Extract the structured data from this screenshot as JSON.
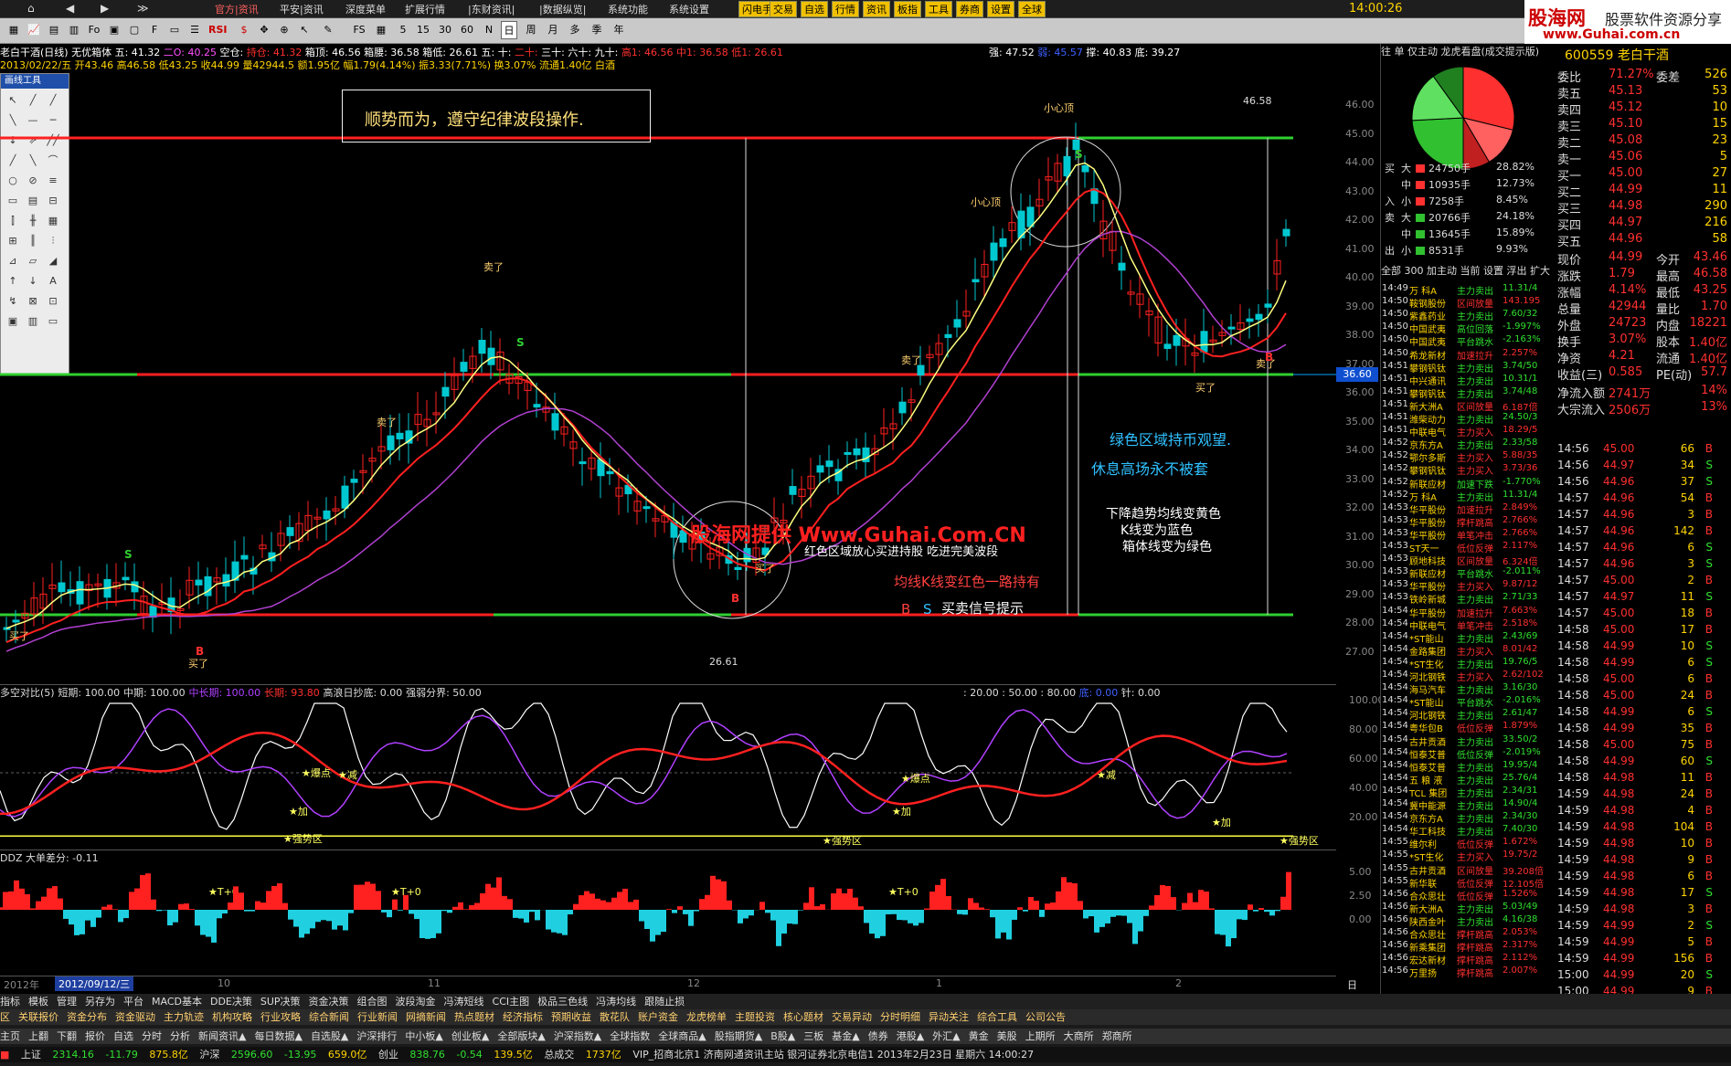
{
  "menu": [
    "官方|资讯",
    "平安|资讯",
    "深度菜单",
    "扩展行情",
    "|东财资讯|",
    "|数据纵览|",
    "系统功能",
    "系统设置"
  ],
  "yellow_buttons": [
    "闪电手",
    "交易",
    "自选",
    "行情",
    "资讯",
    "板指",
    "工具",
    "券商",
    "设置",
    "全球"
  ],
  "clock": "14:00:26",
  "brand": {
    "title": "股海网",
    "subtitle": "股票软件资源分享",
    "url": "www.Guhai.com.cn"
  },
  "toolbar_icons": [
    "RSI",
    "5",
    "15",
    "30",
    "60",
    "N",
    "日",
    "周",
    "月",
    "多",
    "季",
    "年"
  ],
  "info_line1": {
    "name": "老白干酒(日线)",
    "rights": "无优箱体",
    "wu": "五: 41.32",
    "er": "二O: 40.25",
    "kong": "空仓:",
    "shou": "持仓: 41.32",
    "xiang": "箱顶: 46.56",
    "xiang2": "箱腰: 36.58",
    "xiang3": "箱低: 26.61",
    "wu2": "五:",
    "shi": "十:",
    "ershi": "二十:",
    "sanshi": "三十:",
    "liushi": "六十:",
    "jiushi": "九十:",
    "high": "高1: 46.56",
    "mid": "中1: 36.58",
    "low": "低1: 26.61",
    "qiang": "强: 47.52",
    "ruo": "弱: 45.57",
    "cheng": "撑: 40.83",
    "di": "底: 39.27"
  },
  "info_line2": "2013/02/22/五 开43.46 高46.58 低43.25 收44.99 量42944.5 额1.95亿 幅1.79(4.14%) 振3.33(7.71%) 换3.07% 流通1.40亿 白酒",
  "drawtool": {
    "title": "画线工具",
    "icons": [
      "↖",
      "╱",
      "╱",
      "╲",
      "—",
      "─",
      "↕",
      "⇗",
      "╱╱",
      "╱",
      "╲",
      "⌒",
      "○",
      "⊘",
      "≡",
      "▭",
      "▤",
      "⊟",
      "⫿",
      "╫",
      "▦",
      "⊞",
      "║",
      "⫶",
      "⊿",
      "▱",
      "◢",
      "↑",
      "↓",
      "A",
      "↯",
      "⊠",
      "⊡",
      "▣",
      "▥",
      "▭"
    ]
  },
  "slogan": "顺势而为，遵守纪律波段操作.",
  "annotations": {
    "xiaoxin1": "小心顶",
    "xiaoxin2": "小心顶",
    "maile1": "卖了",
    "maile2": "卖了",
    "maile3": "卖了",
    "maile4": "卖了",
    "maile5": "卖了",
    "maile6": "买了",
    "maile7": "买了",
    "maile8": "买了",
    "maile9": "买了",
    "s1": "S",
    "s2": "S",
    "s3": "S",
    "b1": "B",
    "b2": "B",
    "b3": "B",
    "price_top": "46.58",
    "price_bottom": "26.61"
  },
  "watermark": "股海网提供 Www.Guhai.Com.CN",
  "notes": {
    "n1": "红色区域放心买进持股 吃进完美波段",
    "n2": "均线K线变红色一路持有",
    "n3_b": "B",
    "n3_s": "S",
    "n3": "买卖信号提示",
    "n4": "绿色区域持币观望.",
    "n5": "休息高场永不被套",
    "n6": "下降趋势均线变黄色",
    "n7": "K线变为蓝色",
    "n8": "箱体线变为绿色"
  },
  "current_price_tag": "36.60",
  "yaxis": [
    "46.00",
    "45.00",
    "44.00",
    "43.00",
    "42.00",
    "41.00",
    "40.00",
    "39.00",
    "38.00",
    "37.00",
    "36.00",
    "35.00",
    "34.00",
    "33.00",
    "32.00",
    "31.00",
    "30.00",
    "29.00",
    "28.00",
    "27.00"
  ],
  "indicator1": {
    "title": "多空对比(5)",
    "short": "短期: 100.00",
    "mid": "中期: 100.00",
    "mid2": "中长期: 100.00",
    "long": "长期: 93.80",
    "hi": "高浪日抄底: 0.00",
    "qr": "强弱分界: 50.00",
    "levels": ": 20.00 : 50.00 : 80.00",
    "d": "底: 0.00",
    "z": "针: 0.00",
    "axis": [
      "100.00",
      "80.00",
      "60.00",
      "40.00",
      "20.00"
    ]
  },
  "ind_labels": [
    {
      "t": "★爆点"
    },
    {
      "t": "★减"
    },
    {
      "t": "★加"
    },
    {
      "t": "★强势区"
    },
    {
      "t": "★爆点"
    },
    {
      "t": "★加"
    },
    {
      "t": "★强势区"
    },
    {
      "t": "★减"
    },
    {
      "t": "★加"
    },
    {
      "t": "★强势区"
    },
    {
      "t": "★T+0"
    },
    {
      "t": "★T+0"
    },
    {
      "t": "★T+0"
    }
  ],
  "indicator2": {
    "title": "DDZ 大单差分: -0.11",
    "axis": [
      "5.00",
      "2.50",
      "0.00"
    ]
  },
  "xaxis": {
    "y2012": "2012年",
    "date": "2012/09/12/三",
    "m10": "10",
    "m11": "11",
    "m12": "12",
    "m1": "1",
    "m2": "2",
    "rix": "日线"
  },
  "right": {
    "tabs": [
      "往",
      "单",
      "仅主动",
      "龙虎看盘(成交提示版)"
    ],
    "code": "600559 老白干酒",
    "flow": [
      {
        "dir": "买",
        "size": "大",
        "vol": "24750手",
        "pct": "28.82%",
        "color": "#ff3030"
      },
      {
        "dir": "",
        "size": "中",
        "vol": "10935手",
        "pct": "12.73%",
        "color": "#ff3030"
      },
      {
        "dir": "入",
        "size": "小",
        "vol": "7258手",
        "pct": "8.45%",
        "color": "#ff3030"
      },
      {
        "dir": "卖",
        "size": "大",
        "vol": "20766手",
        "pct": "24.18%",
        "color": "#30c030"
      },
      {
        "dir": "",
        "size": "中",
        "vol": "13645手",
        "pct": "15.89%",
        "color": "#30c030"
      },
      {
        "dir": "出",
        "size": "小",
        "vol": "8531手",
        "pct": "9.93%",
        "color": "#30c030"
      }
    ],
    "list_tabs": "全部 300 加主动 当前 设置 浮出 扩大",
    "quote": [
      {
        "k": "委比",
        "v": "71.27%",
        "k2": "委差",
        "v2": "526"
      },
      {
        "k": "卖五",
        "v": "45.13",
        "v2": "53"
      },
      {
        "k": "卖四",
        "v": "45.12",
        "v2": "10"
      },
      {
        "k": "卖三",
        "v": "45.10",
        "v2": "15"
      },
      {
        "k": "卖二",
        "v": "45.08",
        "v2": "23"
      },
      {
        "k": "卖一",
        "v": "45.06",
        "v2": "5"
      },
      {
        "k": "买一",
        "v": "45.00",
        "v2": "27"
      },
      {
        "k": "买二",
        "v": "44.99",
        "v2": "11"
      },
      {
        "k": "买三",
        "v": "44.98",
        "v2": "290"
      },
      {
        "k": "买四",
        "v": "44.97",
        "v2": "216"
      },
      {
        "k": "买五",
        "v": "44.96",
        "v2": "58"
      },
      {
        "k": "现价",
        "v": "44.99",
        "k2": "今开",
        "v2": "43.46"
      },
      {
        "k": "涨跌",
        "v": "1.79",
        "k2": "最高",
        "v2": "46.58"
      },
      {
        "k": "涨幅",
        "v": "4.14%",
        "k2": "最低",
        "v2": "43.25"
      },
      {
        "k": "总量",
        "v": "42944",
        "k2": "量比",
        "v2": "1.70"
      },
      {
        "k": "外盘",
        "v": "24723",
        "k2": "内盘",
        "v2": "18221"
      },
      {
        "k": "换手",
        "v": "3.07%",
        "k2": "股本",
        "v2": "1.40亿"
      },
      {
        "k": "净资",
        "v": "4.21",
        "k2": "流通",
        "v2": "1.40亿"
      },
      {
        "k": "收益(三)",
        "v": "0.585",
        "k2": "PE(动)",
        "v2": "57.7"
      },
      {
        "k": "净流入额",
        "v": "2741万",
        "v2": "14%"
      },
      {
        "k": "大宗流入",
        "v": "2506万",
        "v2": "13%"
      }
    ],
    "news": [
      {
        "t": "14:49",
        "n": "万 科A",
        "a": "主力卖出",
        "v": "11.31/4"
      },
      {
        "t": "14:50",
        "n": "鞍钢股份",
        "a": "区间放量",
        "v": "143.195"
      },
      {
        "t": "14:50",
        "n": "紫鑫药业",
        "a": "主力卖出",
        "v": "7.60/32"
      },
      {
        "t": "14:50",
        "n": "中国武夷",
        "a": "高位回落",
        "v": "-1.997%"
      },
      {
        "t": "14:50",
        "n": "中国武夷",
        "a": "平台跳水",
        "v": "-2.163%"
      },
      {
        "t": "14:50",
        "n": "希龙新材",
        "a": "加速拉升",
        "v": "2.257%"
      },
      {
        "t": "14:51",
        "n": "攀钢钒钛",
        "a": "主力卖出",
        "v": "3.74/50"
      },
      {
        "t": "14:51",
        "n": "中兴通讯",
        "a": "主力卖出",
        "v": "10.31/1"
      },
      {
        "t": "14:51",
        "n": "攀钢钒钛",
        "a": "主力卖出",
        "v": "3.74/48"
      },
      {
        "t": "14:51",
        "n": "新大洲A",
        "a": "区间放量",
        "v": "6.187倍"
      },
      {
        "t": "14:51",
        "n": "潍柴动力",
        "a": "主力卖出",
        "v": "24.50/3"
      },
      {
        "t": "14:51",
        "n": "中联电气",
        "a": "主力买入",
        "v": "18.29/5"
      },
      {
        "t": "14:52",
        "n": "京东方A",
        "a": "主力卖出",
        "v": "2.33/58"
      },
      {
        "t": "14:52",
        "n": "鄂尔多斯",
        "a": "主力买入",
        "v": "5.88/35"
      },
      {
        "t": "14:52",
        "n": "攀钢钒钛",
        "a": "主力买入",
        "v": "3.73/36"
      },
      {
        "t": "14:52",
        "n": "新联应材",
        "a": "加速下跌",
        "v": "-1.770%"
      },
      {
        "t": "14:52",
        "n": "万 科A",
        "a": "主力卖出",
        "v": "11.31/4"
      },
      {
        "t": "14:53",
        "n": "华平股份",
        "a": "加速拉升",
        "v": "2.849%"
      },
      {
        "t": "14:53",
        "n": "华平股份",
        "a": "撑杆跳高",
        "v": "2.766%"
      },
      {
        "t": "14:53",
        "n": "华平股份",
        "a": "单笔冲击",
        "v": "2.766%"
      },
      {
        "t": "14:53",
        "n": "ST天一",
        "a": "低位反弹",
        "v": "2.117%"
      },
      {
        "t": "14:53",
        "n": "顾地科技",
        "a": "区间放量",
        "v": "6.324倍"
      },
      {
        "t": "14:53",
        "n": "新联应材",
        "a": "平台跳水",
        "v": "-2.011%"
      },
      {
        "t": "14:53",
        "n": "华平股份",
        "a": "主力买入",
        "v": "9.87/12"
      },
      {
        "t": "14:53",
        "n": "铁岭新城",
        "a": "主力卖出",
        "v": "2.71/33"
      },
      {
        "t": "14:54",
        "n": "华平股份",
        "a": "加速拉升",
        "v": "7.663%"
      },
      {
        "t": "14:54",
        "n": "中联电气",
        "a": "单笔冲击",
        "v": "2.518%"
      },
      {
        "t": "14:54",
        "n": "*ST能山",
        "a": "主力卖出",
        "v": "2.43/69"
      },
      {
        "t": "14:54",
        "n": "金路集团",
        "a": "主力买入",
        "v": "8.01/42"
      },
      {
        "t": "14:54",
        "n": "*ST生化",
        "a": "主力卖出",
        "v": "19.76/5"
      },
      {
        "t": "14:54",
        "n": "河北钢铁",
        "a": "主力买入",
        "v": "2.62/102"
      },
      {
        "t": "14:54",
        "n": "海马汽车",
        "a": "主力卖出",
        "v": "3.16/30"
      },
      {
        "t": "14:54",
        "n": "*ST能山",
        "a": "平台跳水",
        "v": "-2.016%"
      },
      {
        "t": "14:54",
        "n": "河北钢铁",
        "a": "主力卖出",
        "v": "2.61/47"
      },
      {
        "t": "14:54",
        "n": "粤华包B",
        "a": "低位反弹",
        "v": "1.879%"
      },
      {
        "t": "14:54",
        "n": "古井贡酒",
        "a": "主力卖出",
        "v": "33.50/2"
      },
      {
        "t": "14:54",
        "n": "恒泰艾普",
        "a": "低位反弹",
        "v": "-2.019%"
      },
      {
        "t": "14:54",
        "n": "恒泰艾普",
        "a": "主力卖出",
        "v": "19.95/4"
      },
      {
        "t": "14:54",
        "n": "五 粮 液",
        "a": "主力卖出",
        "v": "25.76/4"
      },
      {
        "t": "14:54",
        "n": "TCL 集团",
        "a": "主力卖出",
        "v": "2.34/31"
      },
      {
        "t": "14:54",
        "n": "冀中能源",
        "a": "主力卖出",
        "v": "14.90/4"
      },
      {
        "t": "14:54",
        "n": "京东方A",
        "a": "主力卖出",
        "v": "2.34/30"
      },
      {
        "t": "14:54",
        "n": "华工科技",
        "a": "主力卖出",
        "v": "7.40/30"
      },
      {
        "t": "14:55",
        "n": "维尔利",
        "a": "低位反弹",
        "v": "1.672%"
      },
      {
        "t": "14:55",
        "n": "*ST生化",
        "a": "主力买入",
        "v": "19.75/2"
      },
      {
        "t": "14:55",
        "n": "古井贡酒",
        "a": "区间放量",
        "v": "39.208倍"
      },
      {
        "t": "14:55",
        "n": "新华联",
        "a": "低位反弹",
        "v": "12.105倍"
      },
      {
        "t": "14:56",
        "n": "合众思壮",
        "a": "低位反弹",
        "v": "1.526%"
      },
      {
        "t": "14:56",
        "n": "新大洲A",
        "a": "主力卖出",
        "v": "5.03/49"
      },
      {
        "t": "14:56",
        "n": "陕西金叶",
        "a": "主力卖出",
        "v": "4.16/38"
      },
      {
        "t": "14:56",
        "n": "合众思壮",
        "a": "撑杆跳高",
        "v": "2.053%"
      },
      {
        "t": "14:56",
        "n": "新乘集团",
        "a": "撑杆跳高",
        "v": "2.317%"
      },
      {
        "t": "14:56",
        "n": "宏达新材",
        "a": "撑杆跳高",
        "v": "2.112%"
      },
      {
        "t": "14:56",
        "n": "万里扬",
        "a": "撑杆跳高",
        "v": "2.007%"
      }
    ],
    "trades": [
      {
        "t": "14:56",
        "p": "45.00",
        "v": "66",
        "d": "B"
      },
      {
        "t": "14:56",
        "p": "44.97",
        "v": "34",
        "d": "S"
      },
      {
        "t": "14:56",
        "p": "44.96",
        "v": "37",
        "d": "S"
      },
      {
        "t": "14:57",
        "p": "44.96",
        "v": "54",
        "d": "B"
      },
      {
        "t": "14:57",
        "p": "44.96",
        "v": "3",
        "d": "B"
      },
      {
        "t": "14:57",
        "p": "44.96",
        "v": "142",
        "d": "B"
      },
      {
        "t": "14:57",
        "p": "44.96",
        "v": "6",
        "d": "S"
      },
      {
        "t": "14:57",
        "p": "44.96",
        "v": "3",
        "d": "S"
      },
      {
        "t": "14:57",
        "p": "45.00",
        "v": "2",
        "d": "B"
      },
      {
        "t": "14:57",
        "p": "44.97",
        "v": "11",
        "d": "S"
      },
      {
        "t": "14:57",
        "p": "45.00",
        "v": "18",
        "d": "B"
      },
      {
        "t": "14:58",
        "p": "45.00",
        "v": "17",
        "d": "B"
      },
      {
        "t": "14:58",
        "p": "44.99",
        "v": "10",
        "d": "S"
      },
      {
        "t": "14:58",
        "p": "44.99",
        "v": "6",
        "d": "S"
      },
      {
        "t": "14:58",
        "p": "45.00",
        "v": "6",
        "d": "B"
      },
      {
        "t": "14:58",
        "p": "45.00",
        "v": "24",
        "d": "B"
      },
      {
        "t": "14:58",
        "p": "44.99",
        "v": "6",
        "d": "S"
      },
      {
        "t": "14:58",
        "p": "44.99",
        "v": "35",
        "d": "B"
      },
      {
        "t": "14:58",
        "p": "45.00",
        "v": "75",
        "d": "B"
      },
      {
        "t": "14:58",
        "p": "44.99",
        "v": "60",
        "d": "S"
      },
      {
        "t": "14:58",
        "p": "44.98",
        "v": "11",
        "d": "B"
      },
      {
        "t": "14:59",
        "p": "44.98",
        "v": "24",
        "d": "B"
      },
      {
        "t": "14:59",
        "p": "44.98",
        "v": "4",
        "d": "B"
      },
      {
        "t": "14:59",
        "p": "44.98",
        "v": "104",
        "d": "B"
      },
      {
        "t": "14:59",
        "p": "44.98",
        "v": "10",
        "d": "B"
      },
      {
        "t": "14:59",
        "p": "44.98",
        "v": "9",
        "d": "B"
      },
      {
        "t": "14:59",
        "p": "44.98",
        "v": "6",
        "d": "B"
      },
      {
        "t": "14:59",
        "p": "44.98",
        "v": "17",
        "d": "S"
      },
      {
        "t": "14:59",
        "p": "44.98",
        "v": "3",
        "d": "B"
      },
      {
        "t": "14:59",
        "p": "44.99",
        "v": "2",
        "d": "S"
      },
      {
        "t": "14:59",
        "p": "44.99",
        "v": "5",
        "d": "B"
      },
      {
        "t": "14:59",
        "p": "44.99",
        "v": "156",
        "d": "B"
      },
      {
        "t": "15:00",
        "p": "44.99",
        "v": "20",
        "d": "S"
      },
      {
        "t": "15:00",
        "p": "44.99",
        "v": "9",
        "d": "B"
      }
    ],
    "tabs_bottom": [
      "资讯总览",
      "主力",
      "分时",
      "风向",
      "关联",
      "笔",
      "价",
      "细",
      "盘",
      "势",
      "指",
      "值",
      "筹"
    ]
  },
  "bottom": {
    "row1": [
      "指标",
      "模板",
      "管理",
      "另存为",
      "平台",
      "MACD基本",
      "DDE决策",
      "SUP决策",
      "资金决策",
      "组合图",
      "波段淘金",
      "冯涛短线",
      "CCI主图",
      "极品三色线",
      "冯涛均线",
      "跟随止损"
    ],
    "row2": [
      "区",
      "关联报价",
      "资金分布",
      "资金驱动",
      "主力轨迹",
      "机构攻略",
      "行业攻略",
      "综合新闻",
      "行业新闻",
      "网摘新闻",
      "热点题材",
      "经济指标",
      "预期收益",
      "散花队",
      "账户资金",
      "龙虎榜单",
      "主题投资",
      "核心题材",
      "交易异动",
      "分时明细",
      "异动关注",
      "综合工具",
      "公司公告"
    ],
    "row3": [
      "主页",
      "上翻",
      "下翻",
      "报价",
      "自选",
      "分时",
      "分析",
      "新闻资讯▲",
      "每日数据▲",
      "自选股▲",
      "沪深排行",
      "中小板▲",
      "创业板▲",
      "全部版块▲",
      "沪深指数▲",
      "全球指数",
      "全球商品▲",
      "股指期货▲",
      "B股▲",
      "三板",
      "基金▲",
      "债券",
      "港股▲",
      "外汇▲",
      "黄金",
      "美股",
      "上期所",
      "大商所",
      "郑商所"
    ],
    "status": {
      "sh": "上证",
      "sh_v": "2314.16",
      "sh_c": "-11.79",
      "sh_a": "875.8亿",
      "hs": "沪深",
      "hs_v": "2596.60",
      "hs_c": "-13.95",
      "hs_a": "659.0亿",
      "cy": "创业",
      "cy_v": "838.76",
      "cy_c": "-0.54",
      "cy_a": "139.5亿",
      "zc": "总成交",
      "zc_v": "1737亿",
      "server": "VIP_招商北京1 济南网通资讯主站 银河证券北京电信1 2013年2月23日 星期六 14:00:27"
    }
  }
}
